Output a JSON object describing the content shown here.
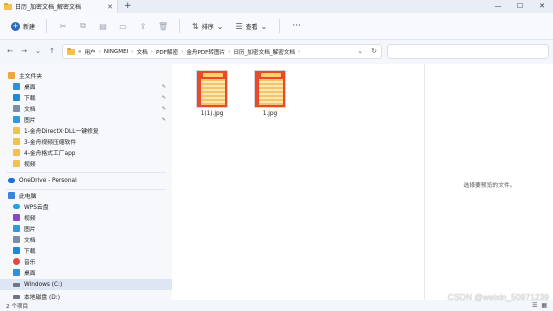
{
  "window": {
    "tab_title": "日历_加密文档_解密文档",
    "new_tab": "+",
    "minimize": "—",
    "maximize": "☐",
    "close": "✕",
    "tab_close": "✕"
  },
  "toolbar": {
    "new_label": "新建",
    "sort_label": "排序",
    "view_label": "查看",
    "more_label": "···"
  },
  "address": {
    "crumbs": [
      "«",
      "用户",
      "NINGMEI",
      "文档",
      "PDF解密",
      "金舟PDF转图片",
      "日历_加密文档_解密文档"
    ],
    "separator": "›"
  },
  "nav_pane": {
    "quick_access": "主文件夹",
    "pinned": [
      "桌面",
      "下载",
      "文档",
      "图片"
    ],
    "folders": [
      "1-金舟DirectX·DLL一键修复",
      "3-金舟视频压缩软件",
      "4-金舟格式工厂app",
      "视频"
    ],
    "onedrive": "OneDrive - Personal",
    "this_pc": "此电脑",
    "pc_items": [
      "WPS云盘",
      "视频",
      "图片",
      "文档",
      "下载",
      "音乐",
      "桌面"
    ],
    "drives": [
      "Windows (C:)",
      "本地磁盘 (D:)"
    ]
  },
  "files": [
    {
      "name": "1(1).jpg"
    },
    {
      "name": "1.jpg"
    }
  ],
  "preview": {
    "message": "选择要预览的文件。"
  },
  "status": {
    "count": "2 个项目"
  },
  "watermark": "CSDN @weixin_50971239"
}
